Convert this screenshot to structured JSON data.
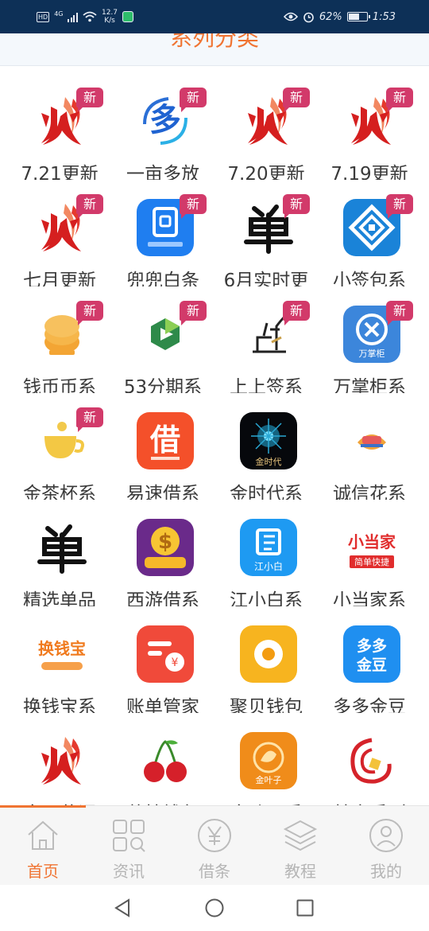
{
  "status_bar": {
    "network": "4G",
    "hd": "HD",
    "speed_value": "12.7",
    "speed_unit": "K/s",
    "battery": "62%",
    "battery_level": 0.62,
    "time": "1:53"
  },
  "header": {
    "title": "系列分类"
  },
  "colors": {
    "accent": "#f07432",
    "badge": "#d23a6a",
    "status_bar": "#0d3057"
  },
  "apps": [
    {
      "label": "7.21更新",
      "badge": "新",
      "icon": "fire-logo-icon"
    },
    {
      "label": "一亩多放",
      "badge": "新",
      "icon": "duo-logo-icon"
    },
    {
      "label": "7.20更新",
      "badge": "新",
      "icon": "fire-logo-icon"
    },
    {
      "label": "7.19更新",
      "badge": "新",
      "icon": "fire-logo-icon"
    },
    {
      "label": "七月更新",
      "badge": "新",
      "icon": "fire-logo-icon"
    },
    {
      "label": "兜兜白条",
      "badge": "新",
      "icon": "blue-square-logo-icon"
    },
    {
      "label": "6月实时更",
      "badge": "新",
      "icon": "calligraphy-logo-icon"
    },
    {
      "label": "小签包系",
      "badge": "新",
      "icon": "blue-diamond-logo-icon"
    },
    {
      "label": "钱币币系",
      "badge": "新",
      "icon": "coin-stack-logo-icon"
    },
    {
      "label": "53分期系",
      "badge": "新",
      "icon": "green-play-logo-icon"
    },
    {
      "label": "上上签系",
      "badge": "新",
      "icon": "ink-sign-logo-icon"
    },
    {
      "label": "万掌柜系",
      "badge": "新",
      "icon": "wanzhanggui-logo-icon"
    },
    {
      "label": "金茶杯系",
      "badge": "新",
      "icon": "golden-cup-logo-icon"
    },
    {
      "label": "易速借系",
      "badge": "",
      "icon": "jie-logo-icon"
    },
    {
      "label": "金时代系",
      "badge": "",
      "icon": "black-burst-logo-icon"
    },
    {
      "label": "诚信花系",
      "badge": "",
      "icon": "handshake-logo-icon"
    },
    {
      "label": "精选单品",
      "badge": "",
      "icon": "calligraphy-logo-icon"
    },
    {
      "label": "西游借系",
      "badge": "",
      "icon": "purple-dollar-logo-icon"
    },
    {
      "label": "江小白系",
      "badge": "",
      "icon": "jiangxiaobai-logo-icon"
    },
    {
      "label": "小当家系",
      "badge": "",
      "icon": "xiaodangjia-logo-icon"
    },
    {
      "label": "换钱宝系",
      "badge": "",
      "icon": "huanqianbao-logo-icon"
    },
    {
      "label": "账单管家",
      "badge": "",
      "icon": "bill-logo-icon"
    },
    {
      "label": "聚贝钱包",
      "badge": "",
      "icon": "yellow-coin-logo-icon"
    },
    {
      "label": "多多金豆",
      "badge": "",
      "icon": "duoduo-logo-icon"
    },
    {
      "label": "金月花词",
      "badge": "",
      "icon": "fire-logo-icon"
    },
    {
      "label": "莓枝钱包",
      "badge": "",
      "icon": "cherry-logo-icon"
    },
    {
      "label": "金叶子系",
      "badge": "",
      "icon": "golden-leaf-logo-icon"
    },
    {
      "label": "林聿系列",
      "badge": "",
      "icon": "red-swirl-logo-icon"
    }
  ],
  "icon_text": {
    "duoduo_line1": "多多",
    "duoduo_line2": "金豆",
    "xiaodangjia": "小当家",
    "xiaodangjia_sub": "简单快捷",
    "huanqianbao": "换钱宝",
    "jiangxiaobai": "江小白",
    "wanzhanggui": "万掌柜",
    "jin_shidai": "金时代",
    "jie": "借",
    "golden_leaf": "金叶子"
  },
  "tabs": [
    {
      "label": "首页",
      "icon": "home-icon",
      "active": true
    },
    {
      "label": "资讯",
      "icon": "grid-search-icon",
      "active": false
    },
    {
      "label": "借条",
      "icon": "yen-circle-icon",
      "active": false
    },
    {
      "label": "教程",
      "icon": "layers-icon",
      "active": false
    },
    {
      "label": "我的",
      "icon": "user-icon",
      "active": false
    }
  ]
}
